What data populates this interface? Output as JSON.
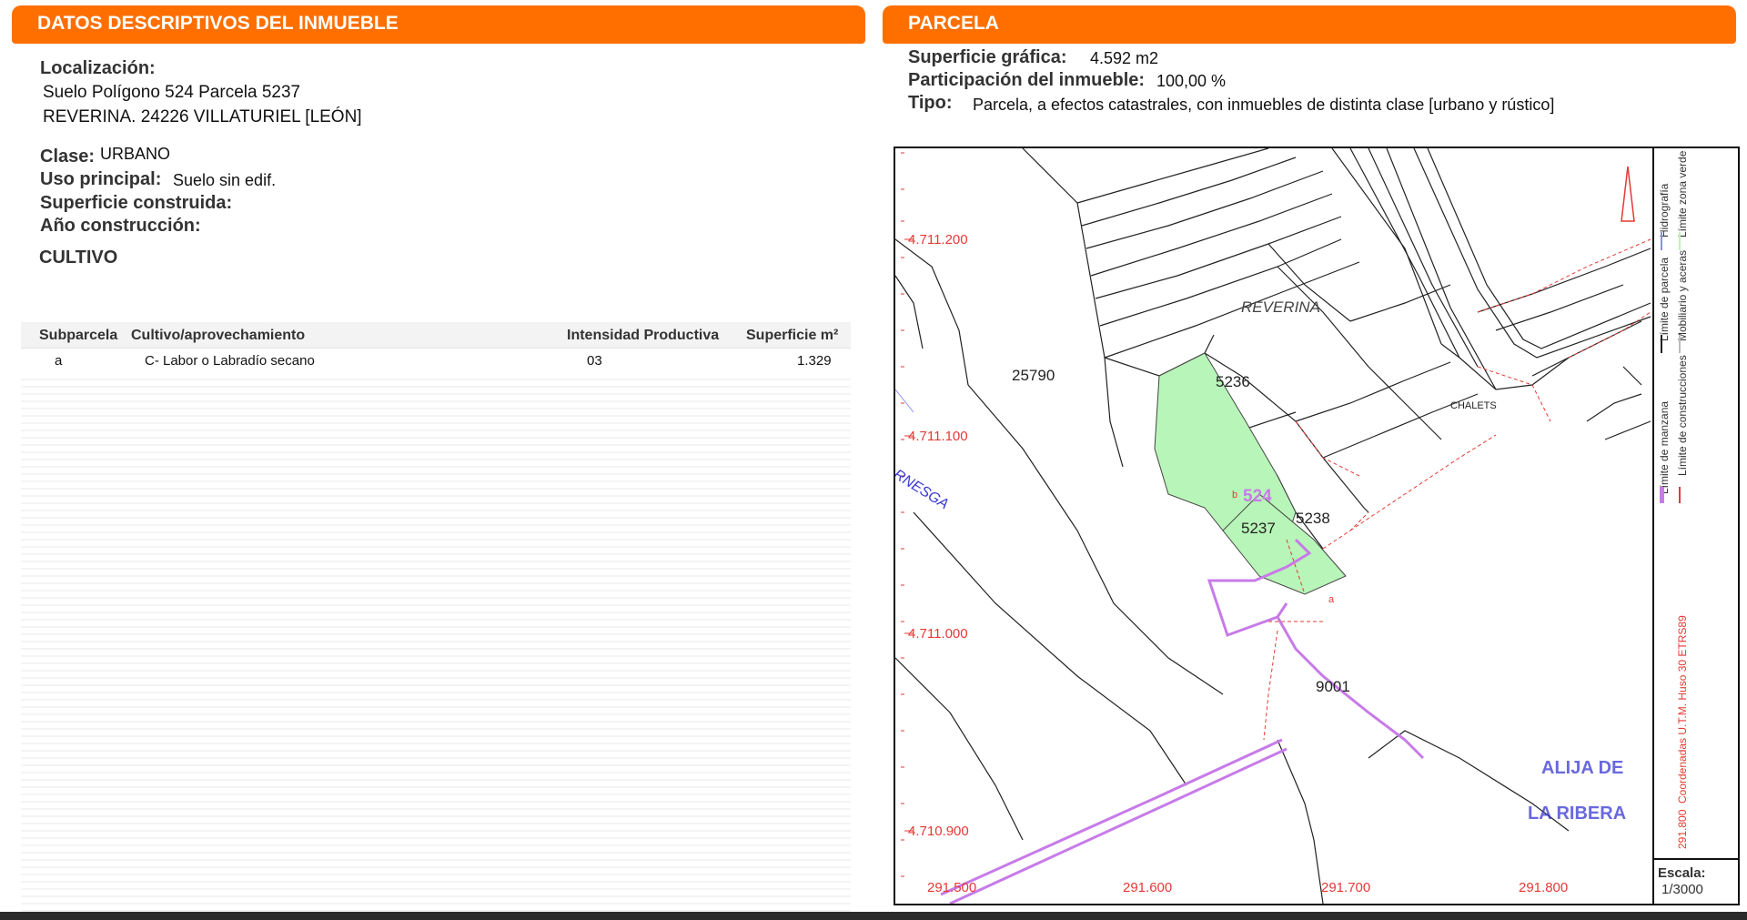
{
  "left": {
    "banner_title": "DATOS DESCRIPTIVOS DEL INMUEBLE",
    "localizacion_label": "Localización:",
    "address_line1": "Suelo Polígono 524 Parcela 5237",
    "address_line2": "REVERINA. 24226 VILLATURIEL [LEÓN]",
    "clase_label": "Clase:",
    "clase_value": "URBANO",
    "uso_label": "Uso principal:",
    "uso_value": "Suelo sin edif.",
    "superficie_construida_label": "Superficie construida:",
    "anio_label": "Año construcción:",
    "cultivo_title": "CULTIVO",
    "table": {
      "headers": [
        "Subparcela",
        "Cultivo/aprovechamiento",
        "Intensidad Productiva",
        "Superficie m²"
      ],
      "rows": [
        {
          "subparcela": "a",
          "cultivo": "C- Labor o Labradío secano",
          "intensidad": "03",
          "superficie": "1.329"
        }
      ]
    }
  },
  "right": {
    "banner_title": "PARCELA",
    "superficie_grafica_label": "Superficie gráfica:",
    "superficie_grafica_value": "4.592 m2",
    "participacion_label": "Participación del inmueble:",
    "participacion_value": "100,00 %",
    "tipo_label": "Tipo:",
    "tipo_value": "Parcela, a efectos catastrales, con inmuebles de distinta clase [urbano y rústico]",
    "map": {
      "y_coords": [
        "4.711.200",
        "4.711.100",
        "4.711.000",
        "4.710.900"
      ],
      "x_coords": [
        "291.500",
        "291.600",
        "291.700",
        "291.800"
      ],
      "place_reverina": "REVERINA",
      "place_chalets": "CHALETS",
      "river": "RNESGA",
      "alija_line1": "ALIJA DE",
      "alija_line2": "LA RIBERA",
      "parcels": [
        "25790",
        "5236",
        "5237",
        "5238",
        "9001"
      ],
      "poligono": "524",
      "subparcel_a": "a",
      "subparcel_b": "b",
      "legend": [
        "Límite de manzana",
        "Límite de parcela",
        "Hidrografía",
        "Límite de construcciones",
        "Mobiliario y aceras",
        "Límite zona verde"
      ],
      "coord_note": "Coordenadas U.T.M. Huso 30 ETRS89",
      "coord_prefix": "291.800",
      "scale_label": "Escala:",
      "scale_value": "1/3000",
      "colors": {
        "manzana": "#c77be8",
        "parcela": "#222222",
        "hidrografia": "#8a8ef2",
        "construcciones": "#e53935",
        "mobiliario": "#bbbbbb",
        "zona_verde": "#b8f5b8"
      }
    }
  }
}
